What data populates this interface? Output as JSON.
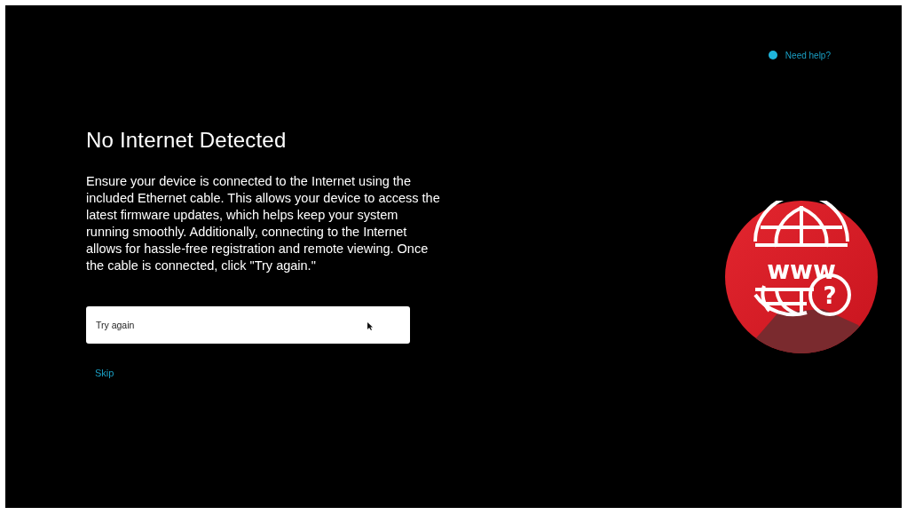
{
  "help_link": {
    "label": "Need help?"
  },
  "title": "No Internet Detected",
  "message": "Ensure your device is connected to the Internet using the included Ethernet cable. This allows your device to access the latest firmware updates, which helps keep your system running smoothly. Additionally, connecting to the Internet allows for hassle-free registration and remote viewing. Once the cable is connected, click \"Try again.\"",
  "buttons": [
    {
      "kind": "primary",
      "label": "Try again"
    },
    {
      "kind": "link",
      "label": "Skip"
    }
  ],
  "illustration": {
    "globe_text": "www",
    "badge_text": "?"
  }
}
